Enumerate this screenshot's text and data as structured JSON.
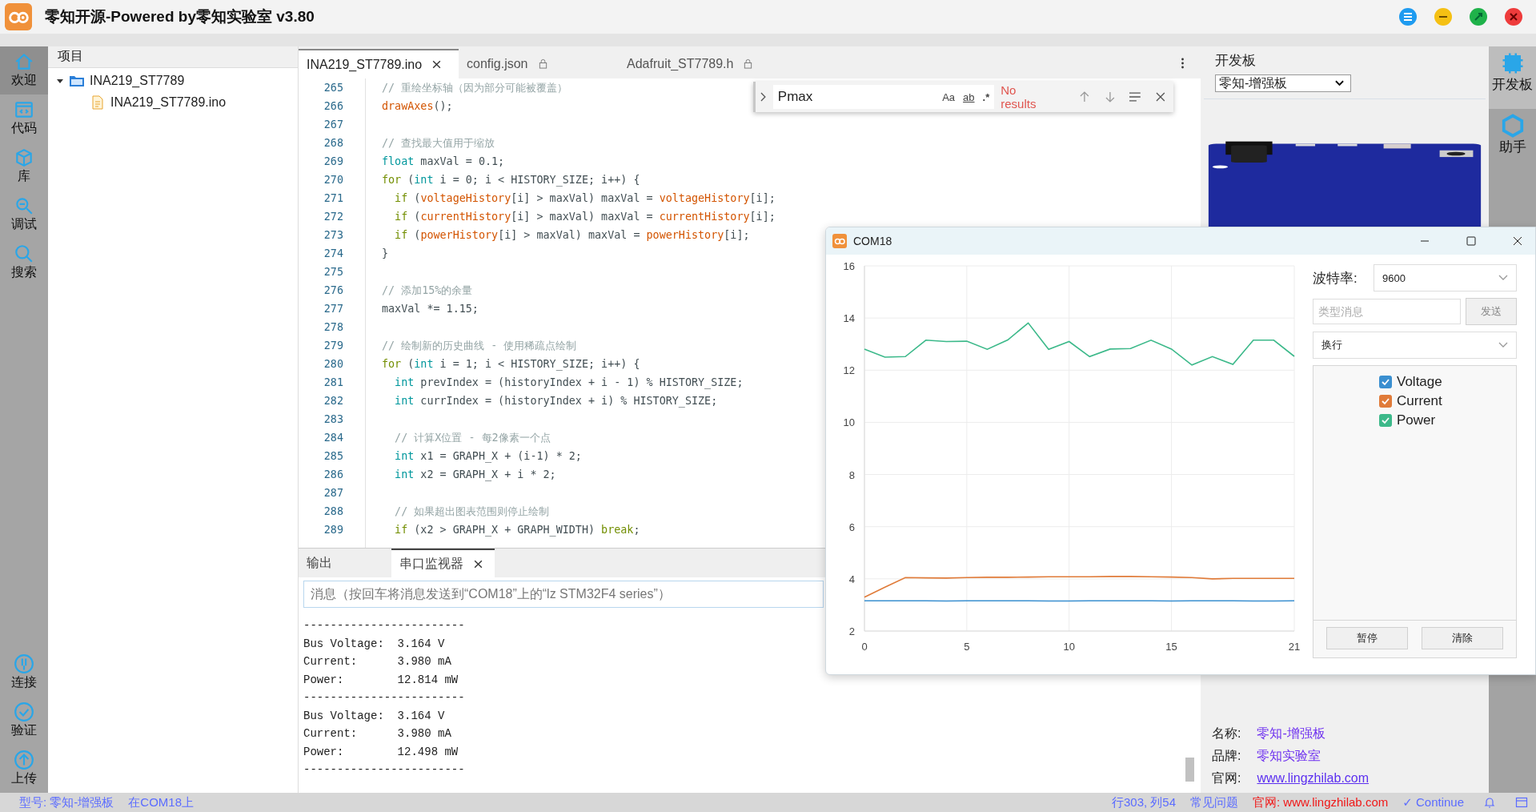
{
  "window": {
    "title": "零知开源-Powered by零知实验室 v3.80"
  },
  "activity_bar": {
    "top": [
      {
        "label": "欢迎",
        "kind": "home",
        "selected": true
      },
      {
        "label": "代码",
        "kind": "code",
        "selected": false
      },
      {
        "label": "库",
        "kind": "cube",
        "selected": false
      },
      {
        "label": "调试",
        "kind": "debug",
        "selected": false
      },
      {
        "label": "搜索",
        "kind": "search",
        "selected": false
      }
    ],
    "bottom": [
      {
        "label": "连接",
        "kind": "plug"
      },
      {
        "label": "验证",
        "kind": "check"
      },
      {
        "label": "上传",
        "kind": "upload"
      }
    ]
  },
  "project": {
    "title": "项目",
    "tree": [
      {
        "label": "INA219_ST7789",
        "kind": "folder",
        "expanded": true,
        "children": [
          {
            "label": "INA219_ST7789.ino",
            "kind": "file"
          }
        ]
      }
    ]
  },
  "editor_tabs": [
    {
      "label": "INA219_ST7789.ino",
      "selected": true,
      "locked": false
    },
    {
      "label": "config.json",
      "selected": false,
      "locked": true
    },
    {
      "label": "Adafruit_ST7789.h",
      "selected": false,
      "locked": true
    }
  ],
  "find": {
    "value": "Pmax",
    "options": [
      "Aa",
      "ab",
      ".*"
    ],
    "result": "No results"
  },
  "code_lines": [
    {
      "number": "265",
      "tokens": [
        {
          "text": "// 重绘坐标轴（因为部分可能被覆盖）",
          "kind": "comment"
        }
      ]
    },
    {
      "number": "266",
      "tokens": [
        {
          "text": "drawAxes",
          "kind": "fn"
        },
        {
          "text": "();",
          "kind": "plain"
        }
      ]
    },
    {
      "number": "267"
    },
    {
      "number": "268",
      "tokens": [
        {
          "text": "// 查找最大值用于缩放",
          "kind": "comment"
        }
      ]
    },
    {
      "number": "269",
      "tokens": [
        {
          "text": "float",
          "kind": "type"
        },
        {
          "text": " maxVal = 0.1;",
          "kind": "plain"
        }
      ]
    },
    {
      "number": "270",
      "tokens": [
        {
          "text": "for",
          "kind": "control"
        },
        {
          "text": " (",
          "kind": "plain"
        },
        {
          "text": "int",
          "kind": "type"
        },
        {
          "text": " i = 0; i < HISTORY_SIZE; i++) {",
          "kind": "plain"
        }
      ]
    },
    {
      "number": "271",
      "tokens": [
        {
          "text": "  if",
          "kind": "control"
        },
        {
          "text": " (",
          "kind": "plain"
        },
        {
          "text": "voltageHistory",
          "kind": "fn"
        },
        {
          "text": "[i] > maxVal) maxVal = ",
          "kind": "plain"
        },
        {
          "text": "voltageHistory",
          "kind": "fn"
        },
        {
          "text": "[i];",
          "kind": "plain"
        }
      ]
    },
    {
      "number": "272",
      "tokens": [
        {
          "text": "  if",
          "kind": "control"
        },
        {
          "text": " (",
          "kind": "plain"
        },
        {
          "text": "currentHistory",
          "kind": "fn"
        },
        {
          "text": "[i] > maxVal) maxVal = ",
          "kind": "plain"
        },
        {
          "text": "currentHistory",
          "kind": "fn"
        },
        {
          "text": "[i];",
          "kind": "plain"
        }
      ]
    },
    {
      "number": "273",
      "tokens": [
        {
          "text": "  if",
          "kind": "control"
        },
        {
          "text": " (",
          "kind": "plain"
        },
        {
          "text": "powerHistory",
          "kind": "fn"
        },
        {
          "text": "[i] > maxVal) maxVal = ",
          "kind": "plain"
        },
        {
          "text": "powerHistory",
          "kind": "fn"
        },
        {
          "text": "[i];",
          "kind": "plain"
        }
      ]
    },
    {
      "number": "274",
      "tokens": [
        {
          "text": "}",
          "kind": "plain"
        }
      ]
    },
    {
      "number": "275"
    },
    {
      "number": "276",
      "tokens": [
        {
          "text": "// 添加15%的余量",
          "kind": "comment"
        }
      ]
    },
    {
      "number": "277",
      "tokens": [
        {
          "text": "maxVal *= 1.15;",
          "kind": "plain"
        }
      ]
    },
    {
      "number": "278"
    },
    {
      "number": "279",
      "tokens": [
        {
          "text": "// 绘制新的历史曲线 - 使用稀疏点绘制",
          "kind": "comment"
        }
      ]
    },
    {
      "number": "280",
      "tokens": [
        {
          "text": "for",
          "kind": "control"
        },
        {
          "text": " (",
          "kind": "plain"
        },
        {
          "text": "int",
          "kind": "type"
        },
        {
          "text": " i = 1; i < HISTORY_SIZE; i++) {",
          "kind": "plain"
        }
      ]
    },
    {
      "number": "281",
      "tokens": [
        {
          "text": "  int",
          "kind": "type"
        },
        {
          "text": " prevIndex = (historyIndex + i - 1) % HISTORY_SIZE;",
          "kind": "plain"
        }
      ]
    },
    {
      "number": "282",
      "tokens": [
        {
          "text": "  int",
          "kind": "type"
        },
        {
          "text": " currIndex = (historyIndex + i) % HISTORY_SIZE;",
          "kind": "plain"
        }
      ]
    },
    {
      "number": "283"
    },
    {
      "number": "284",
      "tokens": [
        {
          "text": "  // 计算X位置 - 每2像素一个点",
          "kind": "comment"
        }
      ]
    },
    {
      "number": "285",
      "tokens": [
        {
          "text": "  int",
          "kind": "type"
        },
        {
          "text": " x1 = GRAPH_X + (i-1) * 2;",
          "kind": "plain"
        }
      ]
    },
    {
      "number": "286",
      "tokens": [
        {
          "text": "  int",
          "kind": "type"
        },
        {
          "text": " x2 = GRAPH_X + i * 2;",
          "kind": "plain"
        }
      ]
    },
    {
      "number": "287"
    },
    {
      "number": "288",
      "tokens": [
        {
          "text": "  // 如果超出图表范围则停止绘制",
          "kind": "comment"
        }
      ]
    },
    {
      "number": "289",
      "tokens": [
        {
          "text": "  if",
          "kind": "control"
        },
        {
          "text": " (x2 > GRAPH_X + GRAPH_WIDTH) ",
          "kind": "plain"
        },
        {
          "text": "break",
          "kind": "control"
        },
        {
          "text": ";",
          "kind": "plain"
        }
      ]
    }
  ],
  "bottom_panel": {
    "tabs": [
      {
        "label": "输出",
        "selected": false,
        "closable": false
      },
      {
        "label": "串口监视器",
        "selected": true,
        "closable": true
      }
    ],
    "message": {
      "placeholder": "消息（按回车将消息发送到“COM18”上的“lz STM32F4 series”）"
    },
    "output": [
      "------------------------",
      "Bus Voltage:  3.164 V",
      "Current:      3.980 mA",
      "Power:        12.814 mW",
      "------------------------",
      "Bus Voltage:  3.164 V",
      "Current:      3.980 mA",
      "Power:        12.498 mW",
      "------------------------"
    ]
  },
  "board_panel": {
    "title": "开发板",
    "board": "零知-增强板",
    "info": [
      {
        "label": "名称:",
        "value": "零知-增强板",
        "kind": "text"
      },
      {
        "label": "品牌:",
        "value": "零知实验室",
        "kind": "text"
      },
      {
        "label": "官网:",
        "value": "www.lingzhilab.com",
        "kind": "link"
      }
    ]
  },
  "right_bar": [
    {
      "label": "开发板",
      "kind": "chip",
      "selected": true
    },
    {
      "label": "助手",
      "kind": "hex",
      "selected": false
    }
  ],
  "serial_plotter": {
    "title": "COM18",
    "baud_label": "波特率:",
    "baud": "9600",
    "message": {
      "placeholder": "类型消息"
    },
    "send": "发送",
    "line_ending": "换行",
    "pause": "暂停",
    "clear": "清除",
    "legend": [
      {
        "checked": true
      },
      {
        "checked": true
      },
      {
        "checked": true
      }
    ],
    "chart_data": {
      "type": "line",
      "grid": true,
      "x": [
        0,
        1,
        2,
        3,
        4,
        5,
        6,
        7,
        8,
        9,
        10,
        11,
        12,
        13,
        14,
        15,
        16,
        17,
        18,
        19,
        20,
        21
      ],
      "xlim": [
        0,
        21
      ],
      "ylim": [
        2,
        16
      ],
      "xticks": [
        0,
        5,
        10,
        15,
        21
      ],
      "yticks": [
        2,
        4,
        6,
        8,
        10,
        12,
        14,
        16
      ],
      "series": [
        {
          "name": "Voltage",
          "color": "#3a8fd0",
          "values": [
            3.16,
            3.16,
            3.16,
            3.16,
            3.15,
            3.16,
            3.16,
            3.16,
            3.16,
            3.15,
            3.15,
            3.16,
            3.16,
            3.16,
            3.16,
            3.15,
            3.16,
            3.16,
            3.16,
            3.15,
            3.15,
            3.16
          ]
        },
        {
          "name": "Current",
          "color": "#e07b39",
          "values": [
            3.3,
            3.68,
            4.05,
            4.04,
            4.03,
            4.05,
            4.06,
            4.06,
            4.07,
            4.08,
            4.08,
            4.08,
            4.09,
            4.09,
            4.08,
            4.07,
            4.05,
            4.0,
            4.02,
            4.02,
            4.02,
            4.02
          ]
        },
        {
          "name": "Power",
          "color": "#3cb98a",
          "values": [
            12.81,
            12.5,
            12.52,
            13.15,
            13.1,
            13.11,
            12.8,
            13.16,
            13.81,
            12.8,
            13.1,
            12.52,
            12.81,
            12.83,
            13.15,
            12.81,
            12.2,
            12.52,
            12.22,
            13.15,
            13.15,
            12.53
          ]
        }
      ]
    }
  },
  "status_bar": {
    "left": [
      "型号: 零知-增强板",
      "在COM18上"
    ],
    "right": [
      {
        "text": "行303, 列54",
        "kind": "plain"
      },
      {
        "text": "常见问题",
        "kind": "plain"
      },
      {
        "text": "官网: www.lingzhilab.com",
        "kind": "alert"
      },
      {
        "text": "✓ Continue",
        "kind": "plain"
      }
    ]
  }
}
